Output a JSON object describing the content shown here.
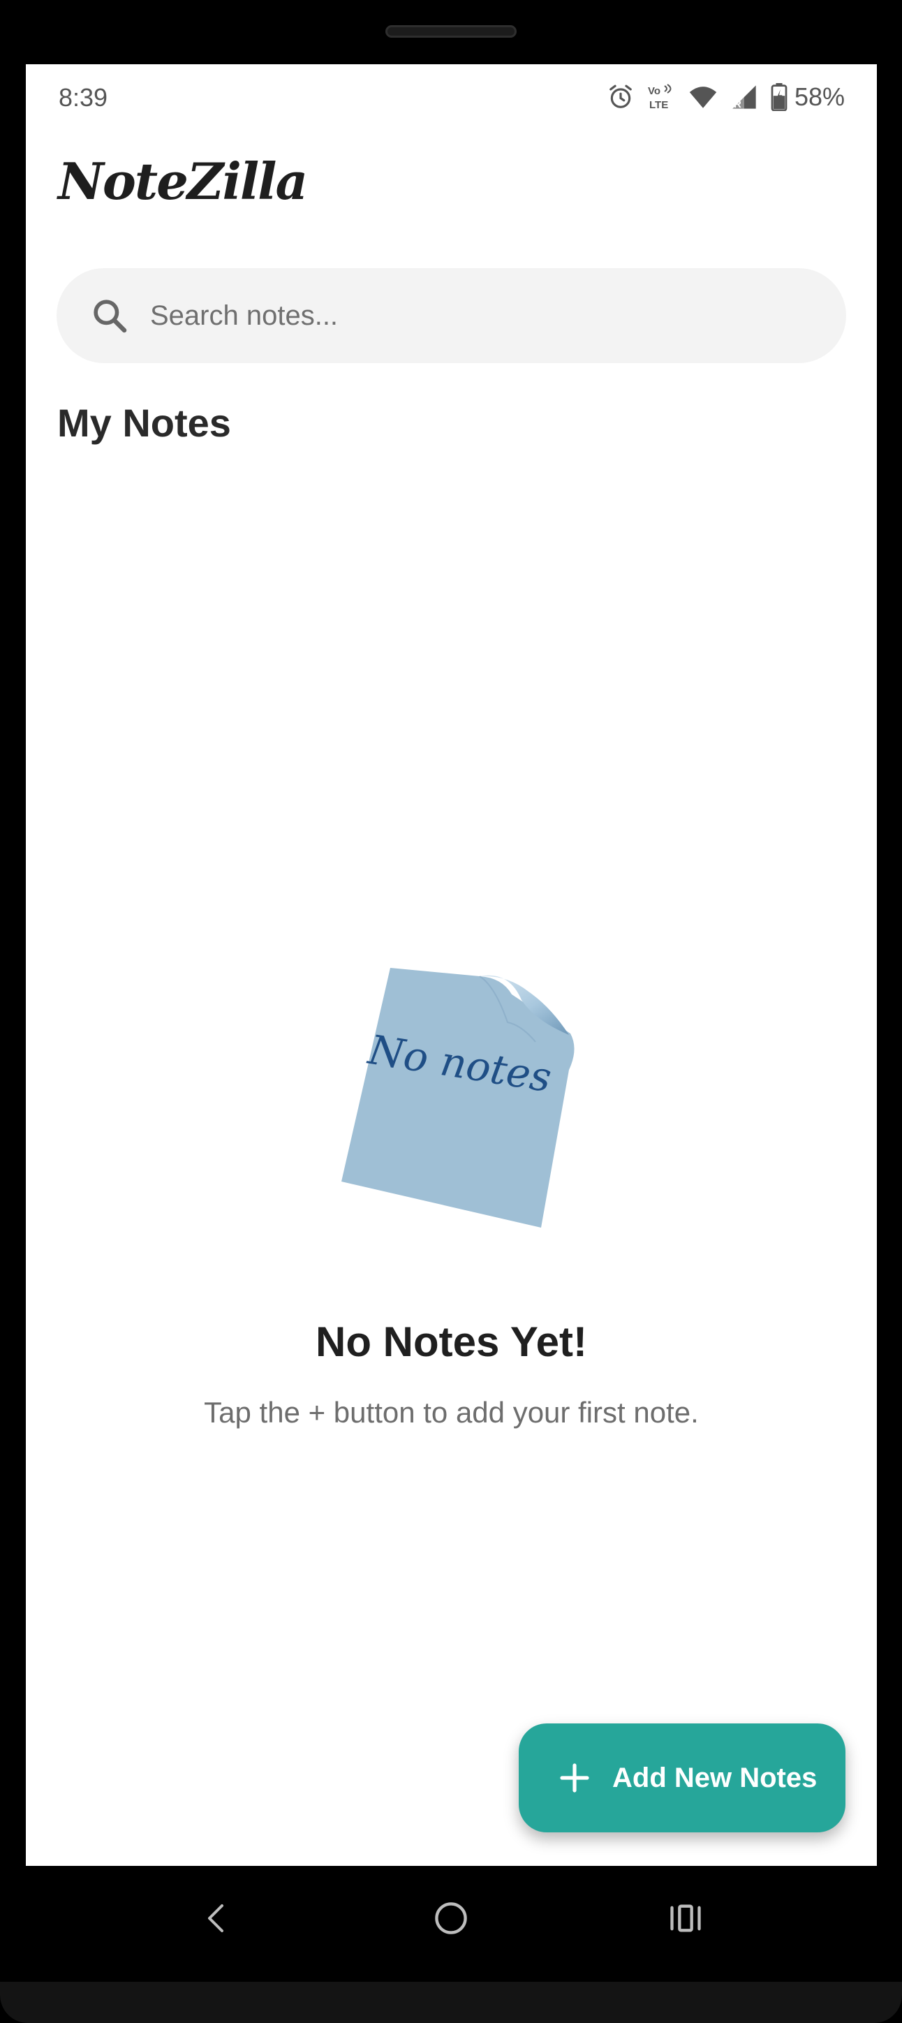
{
  "status_bar": {
    "time": "8:39",
    "battery": "58%",
    "icons": [
      "alarm-icon",
      "volte-icon",
      "wifi-icon",
      "signal-icon",
      "battery-icon"
    ],
    "volte_text_top": "Vo",
    "volte_text_bottom": "LTE"
  },
  "app": {
    "title": "NoteZilla"
  },
  "search": {
    "placeholder": "Search notes...",
    "value": ""
  },
  "main": {
    "section_title": "My Notes",
    "empty_state": {
      "illustration_text": "No notes",
      "title": "No Notes Yet!",
      "subtitle": "Tap the + button to add your first note."
    }
  },
  "fab": {
    "label": "Add New Notes",
    "icon": "plus-icon"
  },
  "colors": {
    "accent": "#26a69a",
    "sticky_note": "#9fc0d6",
    "sticky_text": "#1f4e85"
  },
  "navigation": {
    "buttons": [
      "back-icon",
      "home-icon",
      "recents-icon"
    ]
  }
}
